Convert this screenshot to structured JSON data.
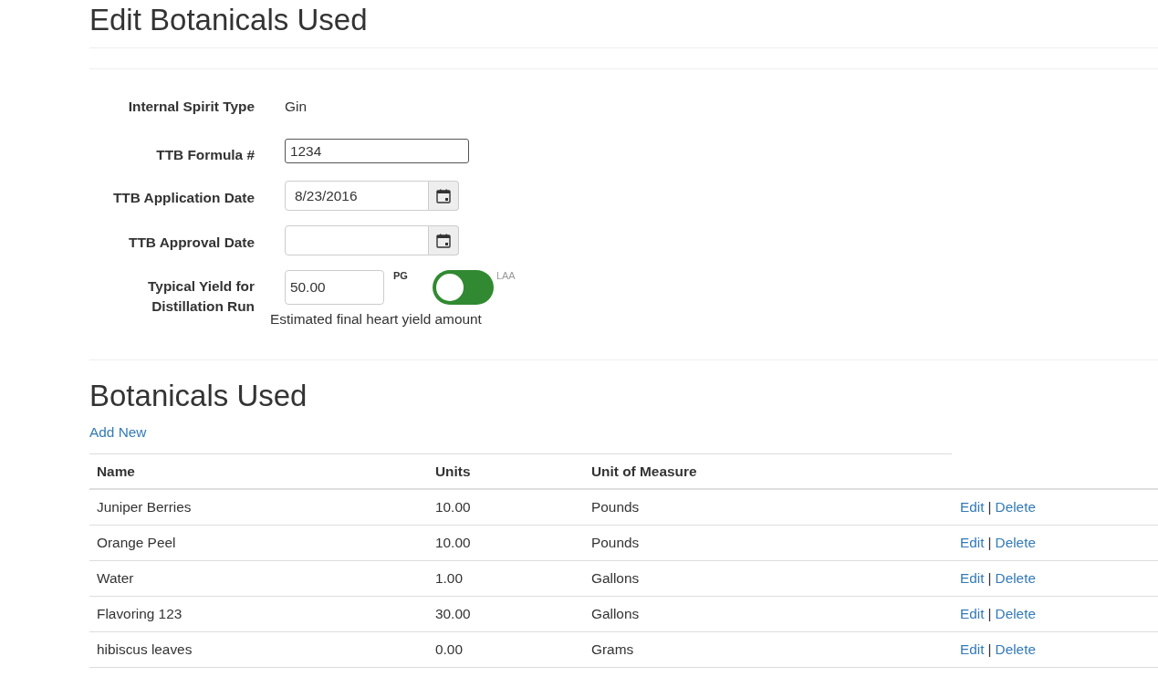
{
  "page_title": "Edit Botanicals Used",
  "form": {
    "fields": [
      {
        "kind": "static",
        "label": "Internal Spirit Type",
        "value": "Gin"
      },
      {
        "kind": "text",
        "label": "TTB Formula #",
        "value": "1234",
        "focused": true
      },
      {
        "kind": "date",
        "label": "TTB Application Date",
        "value": "8/23/2016",
        "focused": false
      },
      {
        "kind": "date",
        "label": "TTB Approval Date",
        "focused": false
      },
      {
        "kind": "yield",
        "label": "Typical Yield for Distillation Run",
        "value": "50.00",
        "focused": false,
        "units": [
          {
            "label": "PG",
            "selected": true
          },
          {
            "label": "LAA",
            "selected": false
          }
        ],
        "help": "Estimated final heart yield amount"
      }
    ]
  },
  "section_title": "Botanicals Used",
  "add_link": "Add New",
  "table": {
    "columns": [
      "Name",
      "Units",
      "Unit of Measure"
    ],
    "rows": [
      {
        "name": "Juniper Berries",
        "units": "10.00",
        "unit_of_measure": "Pounds",
        "actions": [
          "Edit",
          "Delete"
        ],
        "separator": "|"
      },
      {
        "name": "Orange Peel",
        "units": "10.00",
        "unit_of_measure": "Pounds",
        "actions": [
          "Edit",
          "Delete"
        ],
        "separator": "|"
      },
      {
        "name": "Water",
        "units": "1.00",
        "unit_of_measure": "Gallons",
        "actions": [
          "Edit",
          "Delete"
        ],
        "separator": "|"
      },
      {
        "name": "Flavoring 123",
        "units": "30.00",
        "unit_of_measure": "Gallons",
        "actions": [
          "Edit",
          "Delete"
        ],
        "separator": "|"
      },
      {
        "name": "hibiscus leaves",
        "units": "0.00",
        "unit_of_measure": "Grams",
        "actions": [
          "Edit",
          "Delete"
        ],
        "separator": "|"
      }
    ]
  }
}
